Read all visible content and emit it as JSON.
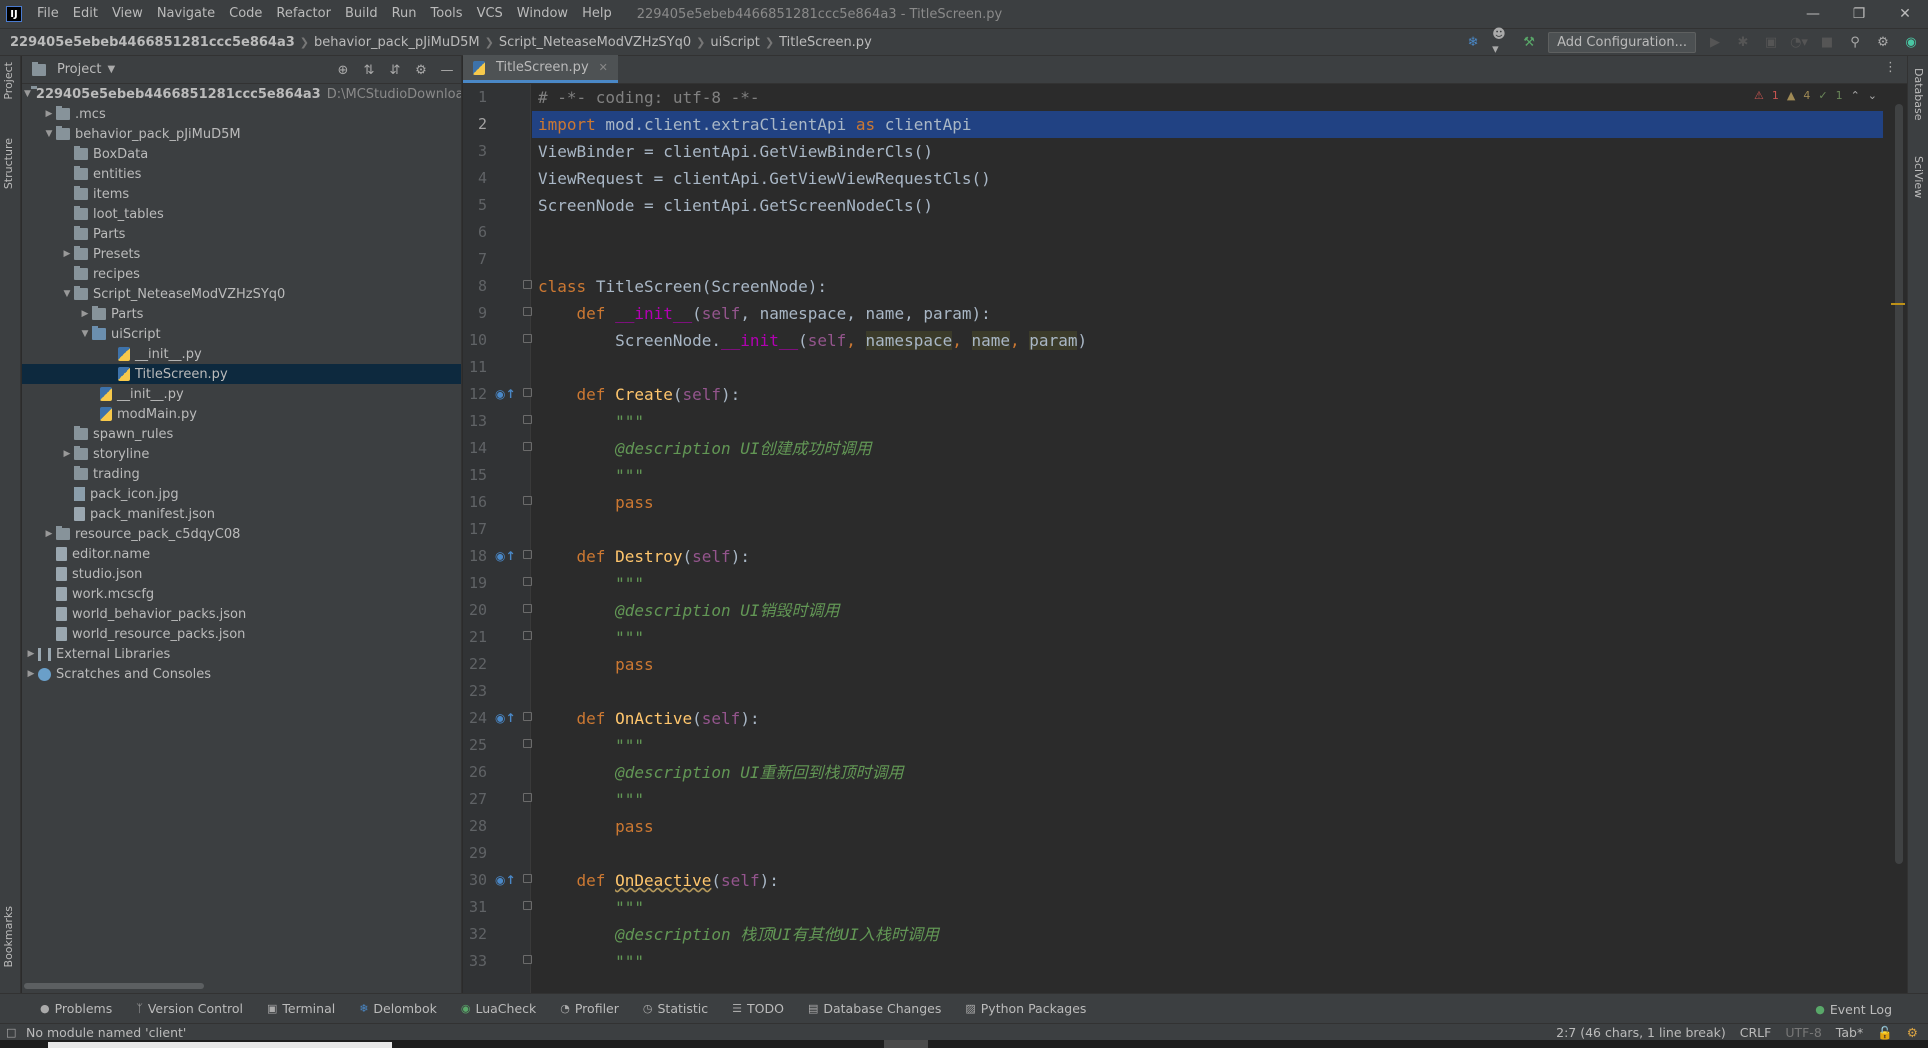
{
  "titlebar": {
    "menus": [
      "File",
      "Edit",
      "View",
      "Navigate",
      "Code",
      "Refactor",
      "Build",
      "Run",
      "Tools",
      "VCS",
      "Window",
      "Help"
    ],
    "window_title": "229405e5ebeb4466851281ccc5e864a3 - TitleScreen.py"
  },
  "navbar": {
    "breadcrumb": [
      "229405e5ebeb4466851281ccc5e864a3",
      "behavior_pack_pJiMuD5M",
      "Script_NeteaseModVZHzSYq0",
      "uiScript",
      "TitleScreen.py"
    ],
    "add_config_label": "Add Configuration..."
  },
  "stripes": {
    "left": [
      "Project",
      "Structure",
      "Bookmarks"
    ],
    "right": [
      "Database",
      "SciView"
    ]
  },
  "project": {
    "title": "Project",
    "root_name": "229405e5ebeb4466851281ccc5e864a3",
    "root_path": "D:\\MCStudioDownload\\work\\",
    "items": [
      ".mcs",
      "behavior_pack_pJiMuD5M",
      "BoxData",
      "entities",
      "items",
      "loot_tables",
      "Parts",
      "Presets",
      "recipes",
      "Script_NeteaseModVZHzSYq0",
      "Parts",
      "uiScript",
      "__init__.py",
      "TitleScreen.py",
      "__init__.py",
      "modMain.py",
      "spawn_rules",
      "storyline",
      "trading",
      "pack_icon.jpg",
      "pack_manifest.json",
      "resource_pack_c5dqyC08",
      "editor.name",
      "studio.json",
      "work.mcscfg",
      "world_behavior_packs.json",
      "world_resource_packs.json",
      "External Libraries",
      "Scratches and Consoles"
    ]
  },
  "editor": {
    "tab_label": "TitleScreen.py",
    "inspections": {
      "errors": "1",
      "warnings": "4",
      "ok": "1"
    },
    "line_numbers": [
      "1",
      "2",
      "3",
      "4",
      "5",
      "6",
      "7",
      "8",
      "9",
      "10",
      "11",
      "12",
      "13",
      "14",
      "15",
      "16",
      "17",
      "18",
      "19",
      "20",
      "21",
      "22",
      "23",
      "24",
      "25",
      "26",
      "27",
      "28",
      "29",
      "30",
      "31",
      "32",
      "33"
    ],
    "lines": {
      "l1": "# -*- coding: utf-8 -*-",
      "l2_kw": "import",
      "l2_rest": " mod.client.extraClientApi ",
      "l2_as": "as",
      "l2_end": " clientApi",
      "l3": "ViewBinder = clientApi.GetViewBinderCls()",
      "l4": "ViewRequest = clientApi.GetViewViewRequestCls()",
      "l5": "ScreenNode = clientApi.GetScreenNodeCls()",
      "class_kw": "class",
      "class_name": "TitleScreen",
      "class_rest": "(ScreenNode):",
      "def_kw": "def",
      "init_name": "__init__",
      "self": "self",
      "init_params": ", namespace, name, param):",
      "l10_a": "ScreenNode.",
      "l10_param1": "namespace",
      "l10_param2": "name",
      "l10_param3": "param",
      "create": "Create",
      "destroy": "Destroy",
      "onactive": "OnActive",
      "ondeactive": "OnDeactive",
      "paren_open": "(",
      "paren_close": "):",
      "triple": "\"\"\"",
      "desc_create": "@description UI创建成功时调用",
      "desc_destroy": "@description UI销毁时调用",
      "desc_active": "@description UI重新回到栈顶时调用",
      "desc_deactive": "@description 栈顶UI有其他UI入栈时调用",
      "pass": "pass"
    }
  },
  "tool_windows": [
    "Problems",
    "Version Control",
    "Terminal",
    "Delombok",
    "LuaCheck",
    "Profiler",
    "Statistic",
    "TODO",
    "Database Changes",
    "Python Packages"
  ],
  "event_log": "Event Log",
  "status": {
    "message": "No module named 'client'",
    "position": "2:7 (46 chars, 1 line break)",
    "line_sep": "CRLF",
    "encoding": "UTF-8",
    "indent": "Tab*"
  }
}
